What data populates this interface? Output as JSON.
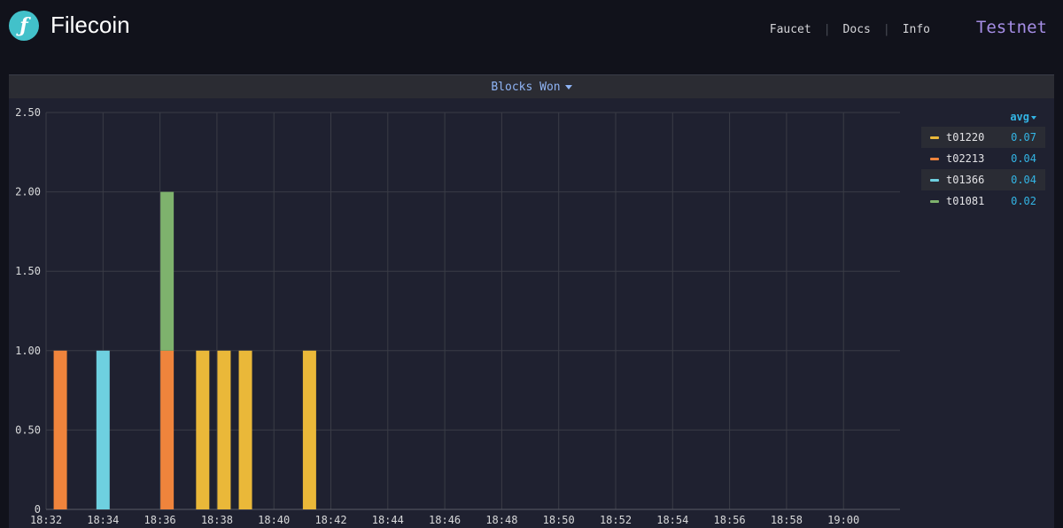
{
  "header": {
    "logo_glyph": "ƒ",
    "brand": "Filecoin",
    "nav": [
      "Faucet",
      "Docs",
      "Info"
    ],
    "network": "Testnet"
  },
  "panel": {
    "title": "Blocks Won"
  },
  "legend": {
    "column": "avg",
    "items": [
      {
        "name": "t01220",
        "value": "0.07",
        "color": "#eab839"
      },
      {
        "name": "t02213",
        "value": "0.04",
        "color": "#ef843c"
      },
      {
        "name": "t01366",
        "value": "0.04",
        "color": "#6ed0e0"
      },
      {
        "name": "t01081",
        "value": "0.02",
        "color": "#7eb26d"
      }
    ]
  },
  "chart_data": {
    "type": "bar",
    "stacked": true,
    "title": "Blocks Won",
    "x_ticks": [
      "18:32",
      "18:34",
      "18:36",
      "18:38",
      "18:40",
      "18:42",
      "18:44",
      "18:46",
      "18:48",
      "18:50",
      "18:52",
      "18:54",
      "18:56",
      "18:58",
      "19:00"
    ],
    "y_ticks": [
      "0",
      "0.50",
      "1.00",
      "1.50",
      "2.00",
      "2.50"
    ],
    "ylim": [
      0,
      2.5
    ],
    "grid": true,
    "legend_placement": "right",
    "series": [
      {
        "name": "t01220",
        "color": "#eab839",
        "points": [
          {
            "x": "18:37:30",
            "y": 1
          },
          {
            "x": "18:38:15",
            "y": 1
          },
          {
            "x": "18:39:00",
            "y": 1
          },
          {
            "x": "18:41:15",
            "y": 1
          }
        ]
      },
      {
        "name": "t02213",
        "color": "#ef843c",
        "points": [
          {
            "x": "18:32:30",
            "y": 1
          },
          {
            "x": "18:36:15",
            "y": 1
          }
        ]
      },
      {
        "name": "t01366",
        "color": "#6ed0e0",
        "points": [
          {
            "x": "18:34:00",
            "y": 1
          }
        ]
      },
      {
        "name": "t01081",
        "color": "#7eb26d",
        "points": [
          {
            "x": "18:36:15",
            "y": 1
          }
        ]
      }
    ]
  }
}
